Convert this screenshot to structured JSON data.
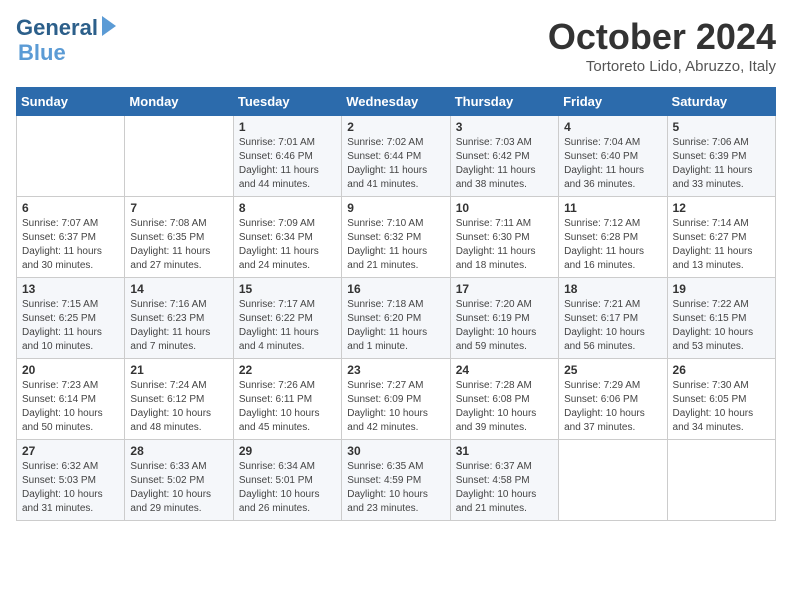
{
  "header": {
    "logo_line1": "General",
    "logo_line2": "Blue",
    "month": "October 2024",
    "location": "Tortoreto Lido, Abruzzo, Italy"
  },
  "weekdays": [
    "Sunday",
    "Monday",
    "Tuesday",
    "Wednesday",
    "Thursday",
    "Friday",
    "Saturday"
  ],
  "weeks": [
    [
      {
        "day": "",
        "details": ""
      },
      {
        "day": "",
        "details": ""
      },
      {
        "day": "1",
        "details": "Sunrise: 7:01 AM\nSunset: 6:46 PM\nDaylight: 11 hours and 44 minutes."
      },
      {
        "day": "2",
        "details": "Sunrise: 7:02 AM\nSunset: 6:44 PM\nDaylight: 11 hours and 41 minutes."
      },
      {
        "day": "3",
        "details": "Sunrise: 7:03 AM\nSunset: 6:42 PM\nDaylight: 11 hours and 38 minutes."
      },
      {
        "day": "4",
        "details": "Sunrise: 7:04 AM\nSunset: 6:40 PM\nDaylight: 11 hours and 36 minutes."
      },
      {
        "day": "5",
        "details": "Sunrise: 7:06 AM\nSunset: 6:39 PM\nDaylight: 11 hours and 33 minutes."
      }
    ],
    [
      {
        "day": "6",
        "details": "Sunrise: 7:07 AM\nSunset: 6:37 PM\nDaylight: 11 hours and 30 minutes."
      },
      {
        "day": "7",
        "details": "Sunrise: 7:08 AM\nSunset: 6:35 PM\nDaylight: 11 hours and 27 minutes."
      },
      {
        "day": "8",
        "details": "Sunrise: 7:09 AM\nSunset: 6:34 PM\nDaylight: 11 hours and 24 minutes."
      },
      {
        "day": "9",
        "details": "Sunrise: 7:10 AM\nSunset: 6:32 PM\nDaylight: 11 hours and 21 minutes."
      },
      {
        "day": "10",
        "details": "Sunrise: 7:11 AM\nSunset: 6:30 PM\nDaylight: 11 hours and 18 minutes."
      },
      {
        "day": "11",
        "details": "Sunrise: 7:12 AM\nSunset: 6:28 PM\nDaylight: 11 hours and 16 minutes."
      },
      {
        "day": "12",
        "details": "Sunrise: 7:14 AM\nSunset: 6:27 PM\nDaylight: 11 hours and 13 minutes."
      }
    ],
    [
      {
        "day": "13",
        "details": "Sunrise: 7:15 AM\nSunset: 6:25 PM\nDaylight: 11 hours and 10 minutes."
      },
      {
        "day": "14",
        "details": "Sunrise: 7:16 AM\nSunset: 6:23 PM\nDaylight: 11 hours and 7 minutes."
      },
      {
        "day": "15",
        "details": "Sunrise: 7:17 AM\nSunset: 6:22 PM\nDaylight: 11 hours and 4 minutes."
      },
      {
        "day": "16",
        "details": "Sunrise: 7:18 AM\nSunset: 6:20 PM\nDaylight: 11 hours and 1 minute."
      },
      {
        "day": "17",
        "details": "Sunrise: 7:20 AM\nSunset: 6:19 PM\nDaylight: 10 hours and 59 minutes."
      },
      {
        "day": "18",
        "details": "Sunrise: 7:21 AM\nSunset: 6:17 PM\nDaylight: 10 hours and 56 minutes."
      },
      {
        "day": "19",
        "details": "Sunrise: 7:22 AM\nSunset: 6:15 PM\nDaylight: 10 hours and 53 minutes."
      }
    ],
    [
      {
        "day": "20",
        "details": "Sunrise: 7:23 AM\nSunset: 6:14 PM\nDaylight: 10 hours and 50 minutes."
      },
      {
        "day": "21",
        "details": "Sunrise: 7:24 AM\nSunset: 6:12 PM\nDaylight: 10 hours and 48 minutes."
      },
      {
        "day": "22",
        "details": "Sunrise: 7:26 AM\nSunset: 6:11 PM\nDaylight: 10 hours and 45 minutes."
      },
      {
        "day": "23",
        "details": "Sunrise: 7:27 AM\nSunset: 6:09 PM\nDaylight: 10 hours and 42 minutes."
      },
      {
        "day": "24",
        "details": "Sunrise: 7:28 AM\nSunset: 6:08 PM\nDaylight: 10 hours and 39 minutes."
      },
      {
        "day": "25",
        "details": "Sunrise: 7:29 AM\nSunset: 6:06 PM\nDaylight: 10 hours and 37 minutes."
      },
      {
        "day": "26",
        "details": "Sunrise: 7:30 AM\nSunset: 6:05 PM\nDaylight: 10 hours and 34 minutes."
      }
    ],
    [
      {
        "day": "27",
        "details": "Sunrise: 6:32 AM\nSunset: 5:03 PM\nDaylight: 10 hours and 31 minutes."
      },
      {
        "day": "28",
        "details": "Sunrise: 6:33 AM\nSunset: 5:02 PM\nDaylight: 10 hours and 29 minutes."
      },
      {
        "day": "29",
        "details": "Sunrise: 6:34 AM\nSunset: 5:01 PM\nDaylight: 10 hours and 26 minutes."
      },
      {
        "day": "30",
        "details": "Sunrise: 6:35 AM\nSunset: 4:59 PM\nDaylight: 10 hours and 23 minutes."
      },
      {
        "day": "31",
        "details": "Sunrise: 6:37 AM\nSunset: 4:58 PM\nDaylight: 10 hours and 21 minutes."
      },
      {
        "day": "",
        "details": ""
      },
      {
        "day": "",
        "details": ""
      }
    ]
  ]
}
